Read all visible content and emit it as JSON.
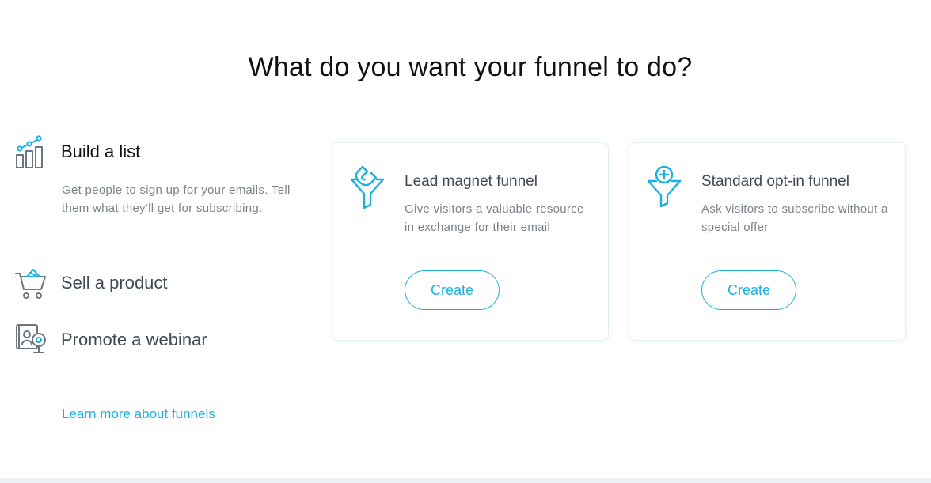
{
  "heading": "What do you want your funnel to do?",
  "goals": [
    {
      "label": "Build a list",
      "icon": "bar-chart-growth-icon",
      "active": true,
      "description": "Get people to sign up for your emails. Tell them what they'll get for subscribing."
    },
    {
      "label": "Sell a product",
      "icon": "shopping-cart-icon",
      "active": false
    },
    {
      "label": "Promote a webinar",
      "icon": "webinar-camera-icon",
      "active": false
    }
  ],
  "learn_more": "Learn more about funnels",
  "cards": [
    {
      "title": "Lead magnet funnel",
      "icon": "magnet-funnel-icon",
      "description": "Give visitors a valuable resource in exchange for their email",
      "button": "Create"
    },
    {
      "title": "Standard opt-in funnel",
      "icon": "opt-in-funnel-icon",
      "description": "Ask visitors to subscribe without a special offer",
      "button": "Create"
    }
  ],
  "colors": {
    "accent": "#1ab0e0",
    "icon_gray": "#6b7680",
    "text_dark": "#3f4a55",
    "text_muted": "#7a838b"
  }
}
